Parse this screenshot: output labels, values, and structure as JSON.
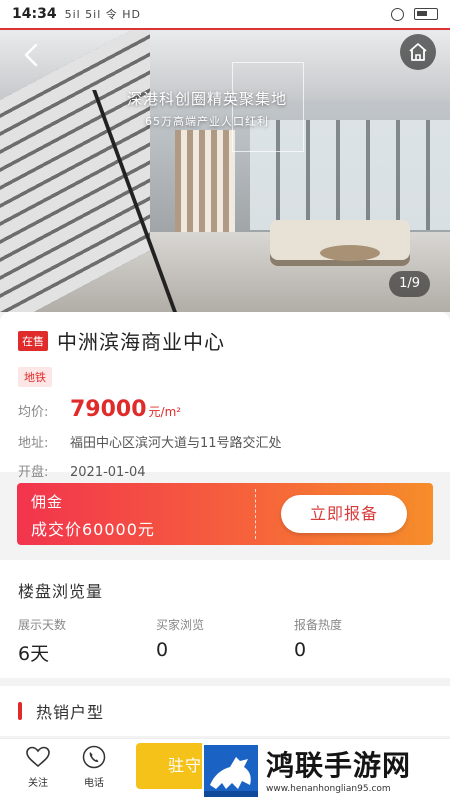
{
  "status_bar": {
    "time": "14:34",
    "signal_text": "5il 5il 令 HD"
  },
  "hero": {
    "title": "深港科创圈精英聚集地",
    "subtitle": "65万高端产业人口红利",
    "pager": "1/9"
  },
  "project": {
    "status_badge": "在售",
    "name": "中洲滨海商业中心",
    "tag": "地铁",
    "price_label": "均价:",
    "price_value": "79000",
    "price_unit": "元/m²",
    "address_label": "地址:",
    "address_value": "福田中心区滨河大道与11号路交汇处",
    "open_label": "开盘:",
    "open_value": "2021-01-04"
  },
  "commission": {
    "line1": "佣金",
    "line2": "成交价60000元",
    "report_button": "立即报备"
  },
  "stats": {
    "title": "楼盘浏览量",
    "items": [
      {
        "label": "展示天数",
        "value": "6天"
      },
      {
        "label": "买家浏览",
        "value": "0"
      },
      {
        "label": "报备热度",
        "value": "0"
      }
    ]
  },
  "hot_sale": {
    "title": "热销户型"
  },
  "bottom_bar": {
    "follow_label": "关注",
    "phone_label": "电话",
    "stay_button": "驻守"
  },
  "watermark": {
    "brand": "鸿联手游网",
    "url": "www.henanhonglian95.com"
  },
  "colors": {
    "accent_red": "#e02b2b",
    "commission_gradient_start": "#f2344d",
    "commission_gradient_end": "#f68d2a",
    "stay_button_yellow": "#f5c21a"
  }
}
